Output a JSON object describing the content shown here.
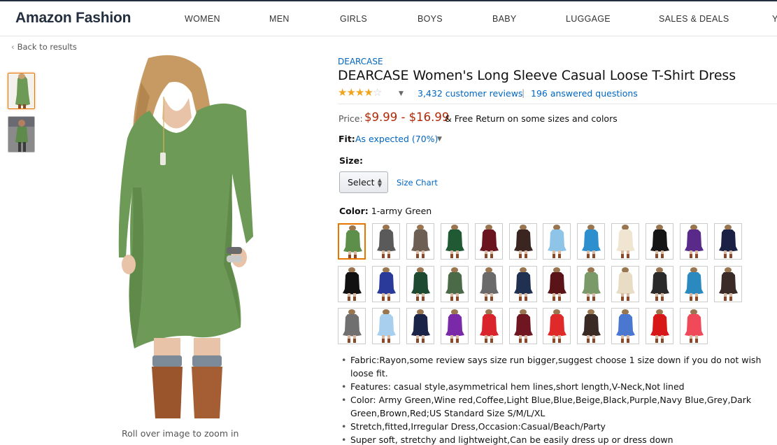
{
  "header": {
    "brand": "Amazon Fashion",
    "nav": [
      "WOMEN",
      "MEN",
      "GIRLS",
      "BOYS",
      "BABY",
      "LUGGAGE",
      "SALES & DEALS",
      "Y"
    ]
  },
  "back_label": "Back to results",
  "gallery": {
    "zoom_hint": "Roll over image to zoom in",
    "thumbnails": [
      "thumbnail-1",
      "thumbnail-2"
    ],
    "main_color": "#6e9a58"
  },
  "product": {
    "byline": "DEARCASE",
    "title": "DEARCASE Women's Long Sleeve Casual Loose T-Shirt Dress",
    "rating": 4,
    "reviews_label": "3,432 customer reviews",
    "separator": "|",
    "questions_label": "196 answered questions",
    "price_label": "Price:",
    "price": "$9.99 - $16.99",
    "free_return": "& Free Return on some sizes and colors",
    "fit_label": "Fit:",
    "fit_value": "As expected (70%)",
    "size_label": "Size:",
    "size_select": "Select",
    "size_chart": "Size Chart",
    "color_label": "Color:",
    "color_value": "1-army Green",
    "swatches": [
      {
        "color": "#5e8f4a",
        "selected": true
      },
      {
        "color": "#5a5a5a"
      },
      {
        "color": "#6e5f55"
      },
      {
        "color": "#1f5a35"
      },
      {
        "color": "#6a1420"
      },
      {
        "color": "#3a2520"
      },
      {
        "color": "#8ec4e8"
      },
      {
        "color": "#2e8fcf"
      },
      {
        "color": "#efe5d0"
      },
      {
        "color": "#151515"
      },
      {
        "color": "#5a2a8a"
      },
      {
        "color": "#1b2145"
      },
      {
        "color": "#111111"
      },
      {
        "color": "#2a3a9a"
      },
      {
        "color": "#1f4a32"
      },
      {
        "color": "#4a6a48"
      },
      {
        "color": "#6a6a6a"
      },
      {
        "color": "#1f3050"
      },
      {
        "color": "#5a1418"
      },
      {
        "color": "#7a9a6a"
      },
      {
        "color": "#e8dcc5"
      },
      {
        "color": "#2a2a2a"
      },
      {
        "color": "#2a8ac0"
      },
      {
        "color": "#3a2a28"
      },
      {
        "color": "#707070"
      },
      {
        "color": "#a8d0ee"
      },
      {
        "color": "#1a2448"
      },
      {
        "color": "#7a2aa8"
      },
      {
        "color": "#d8242a"
      },
      {
        "color": "#701620"
      },
      {
        "color": "#e02a2a"
      },
      {
        "color": "#3a2a25"
      },
      {
        "color": "#4a78d0"
      },
      {
        "color": "#d81818"
      },
      {
        "color": "#f04a5a"
      }
    ],
    "bullets": [
      "Fabric:Rayon,some review says size run bigger,suggest choose 1 size down if you do not wish loose fit.",
      "Features: casual style,asymmetrical hem lines,short length,V-Neck,Not lined",
      "Color: Army Green,Wine red,Coffee,Light Blue,Blue,Beige,Black,Purple,Navy Blue,Grey,Dark Green,Brown,Red;US Standard Size S/M/L/XL",
      "Stretch,fitted,Irregular Dress,Occasion:Casual/Beach/Party",
      "Super soft, stretchy and lightweight,Can be easily dress up or dress down"
    ]
  }
}
